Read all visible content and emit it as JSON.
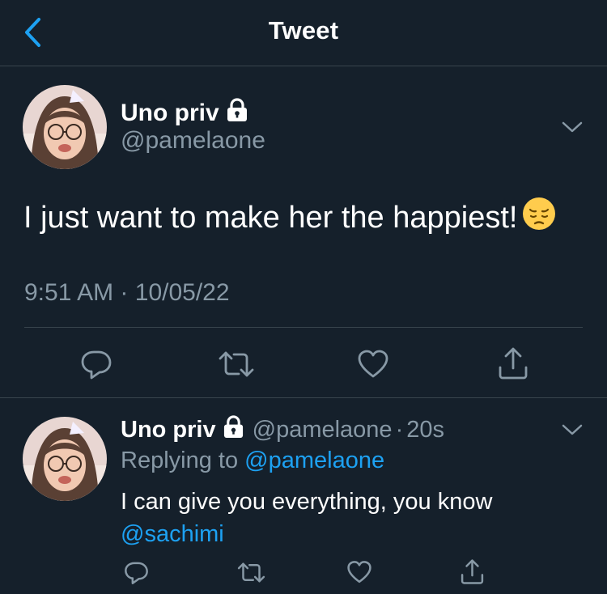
{
  "header": {
    "title": "Tweet"
  },
  "main_tweet": {
    "display_name": "Uno priv",
    "handle": "@pamelaone",
    "text": "I just want to make her the happiest!",
    "emoji": "pensive-face",
    "time": "9:51 AM",
    "separator": "·",
    "date": "10/05/22"
  },
  "reply": {
    "display_name": "Uno priv",
    "handle": "@pamelaone",
    "separator": "·",
    "age": "20s",
    "replying_prefix": "Replying to",
    "replying_to": "@pamelaone",
    "text": "I can give you everything, you know",
    "mention": "@sachimi"
  },
  "icons": {
    "back": "chevron-left-icon",
    "lock": "lock-icon",
    "more": "chevron-down-icon",
    "reply": "reply-icon",
    "retweet": "retweet-icon",
    "like": "heart-icon",
    "share": "share-icon"
  },
  "colors": {
    "background": "#15202b",
    "divider": "#38444d",
    "secondary_text": "#8899a6",
    "accent": "#1da1f2",
    "primary_text": "#ffffff"
  }
}
